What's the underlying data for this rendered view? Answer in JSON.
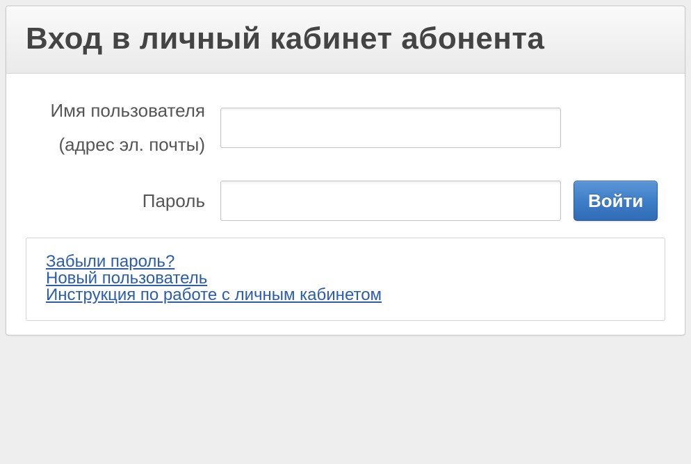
{
  "header": {
    "title": "Вход в личный кабинет абонента"
  },
  "form": {
    "username_label_line1": "Имя пользователя",
    "username_label_line2": "(адрес эл. почты)",
    "username_value": "",
    "password_label": "Пароль",
    "password_value": "",
    "submit_label": "Войти"
  },
  "links": {
    "forgot": "Забыли пароль?",
    "new_user": "Новый пользователь",
    "manual": "Инструкция по работе с личным кабинетом"
  }
}
